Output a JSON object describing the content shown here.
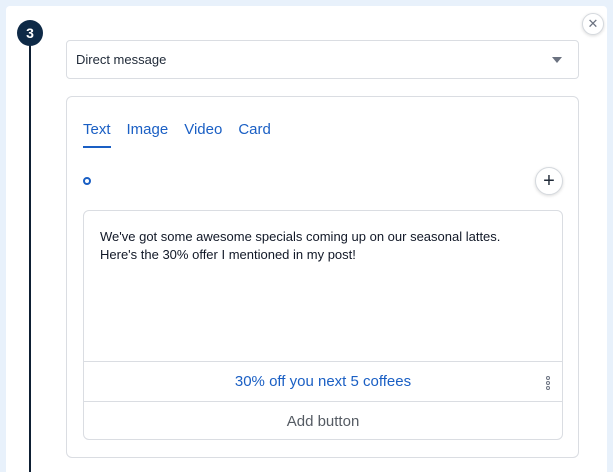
{
  "step": {
    "number": "3"
  },
  "close": {
    "glyph": "✕"
  },
  "channel_select": {
    "value": "Direct message"
  },
  "tabs": [
    {
      "label": "Text",
      "active": true
    },
    {
      "label": "Image",
      "active": false
    },
    {
      "label": "Video",
      "active": false
    },
    {
      "label": "Card",
      "active": false
    }
  ],
  "add": {
    "glyph": "+"
  },
  "message": {
    "line1": "We've got some awesome specials coming up on our seasonal lattes.",
    "line2": "Here's the 30% offer I mentioned in my post!"
  },
  "buttons": {
    "offer_label": "30% off you next 5 coffees",
    "add_label": "Add button"
  },
  "colors": {
    "accent": "#1a5fc4",
    "badge": "#0e2a47"
  }
}
